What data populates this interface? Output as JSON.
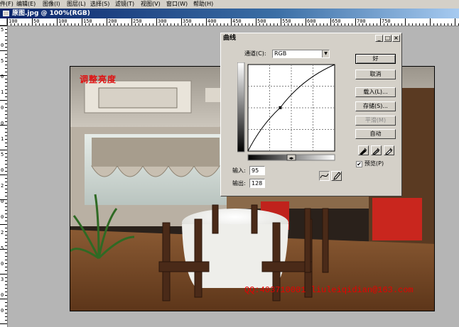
{
  "menu": [
    "件(F)",
    "编辑(E)",
    "图像(I)",
    "图层(L)",
    "选择(S)",
    "滤镜(T)",
    "视图(V)",
    "窗口(W)",
    "帮助(H)"
  ],
  "document": {
    "title": "原图.jpg @ 100%(RGB)",
    "ruler_labels": [
      "100",
      "50",
      "100",
      "150",
      "200",
      "250",
      "300",
      "350",
      "400",
      "450",
      "500",
      "550",
      "600",
      "650",
      "700",
      "750"
    ],
    "vruler_labels": [
      "5",
      "0",
      "5",
      "0",
      "1",
      "0",
      "0",
      "1",
      "5",
      "0",
      "2",
      "0",
      "0",
      "2",
      "5",
      "0",
      "3",
      "0",
      "0"
    ]
  },
  "image": {
    "overlay_title": "调整亮度",
    "watermark": "QQ:403710001    liuleiqidian@163.com"
  },
  "curves": {
    "title": "曲线",
    "channel_label": "通道(C):",
    "channel_value": "RGB",
    "input_label": "输入:",
    "input_value": "95",
    "output_label": "输出:",
    "output_value": "128",
    "buttons": {
      "ok": "好",
      "cancel": "取消",
      "load": "载入(L)...",
      "save": "存储(S)...",
      "smooth": "平滑(M)",
      "auto": "自动"
    },
    "preview_label": "预览(P)",
    "preview_checked": true,
    "curve_point": {
      "input": 95,
      "output": 128
    }
  },
  "colors": {
    "accent_title": "#0a246a",
    "overlay_red": "#e01010"
  }
}
